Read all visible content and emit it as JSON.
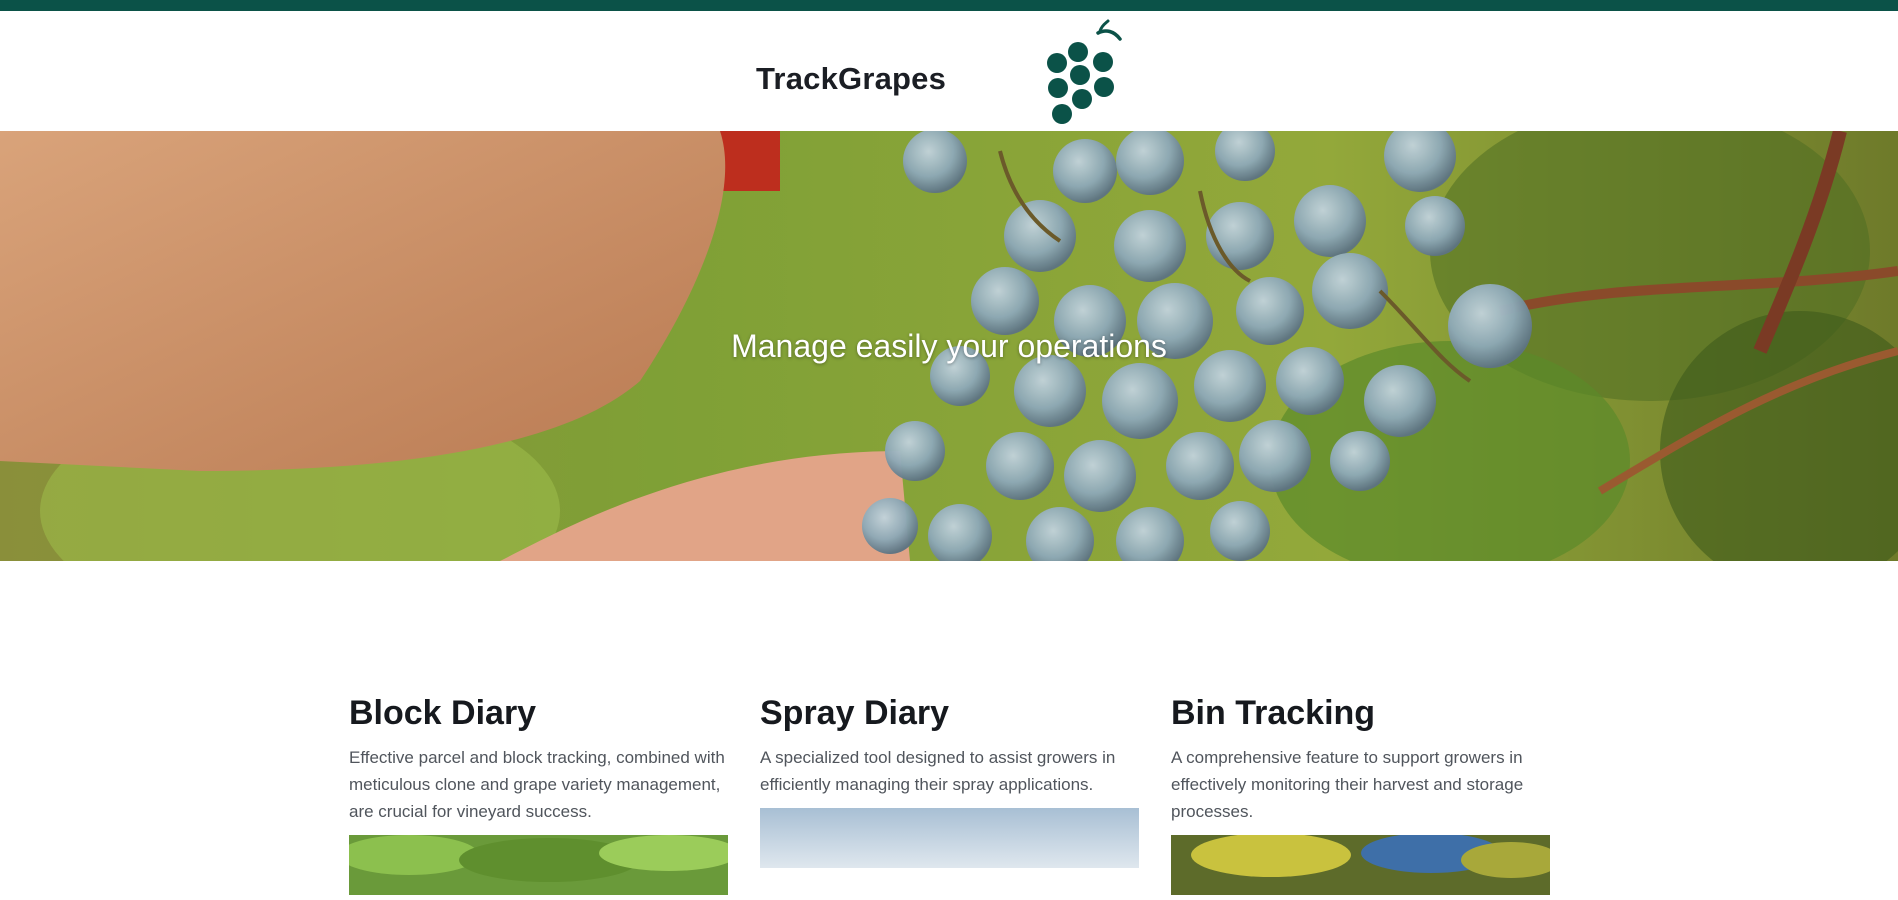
{
  "brand": {
    "name": "TrackGrapes",
    "logo_icon": "grape-bunch-icon",
    "color": "#0b5248"
  },
  "hero": {
    "tagline": "Manage easily your operations"
  },
  "features": [
    {
      "title": "Block Diary",
      "description": "Effective parcel and block tracking, combined with meticulous clone and grape variety management, are crucial for vineyard success."
    },
    {
      "title": "Spray Diary",
      "description": "A specialized tool designed to assist growers in efficiently managing their spray applications."
    },
    {
      "title": "Bin Tracking",
      "description": "A comprehensive feature to support growers in effectively monitoring their harvest and storage processes."
    }
  ]
}
